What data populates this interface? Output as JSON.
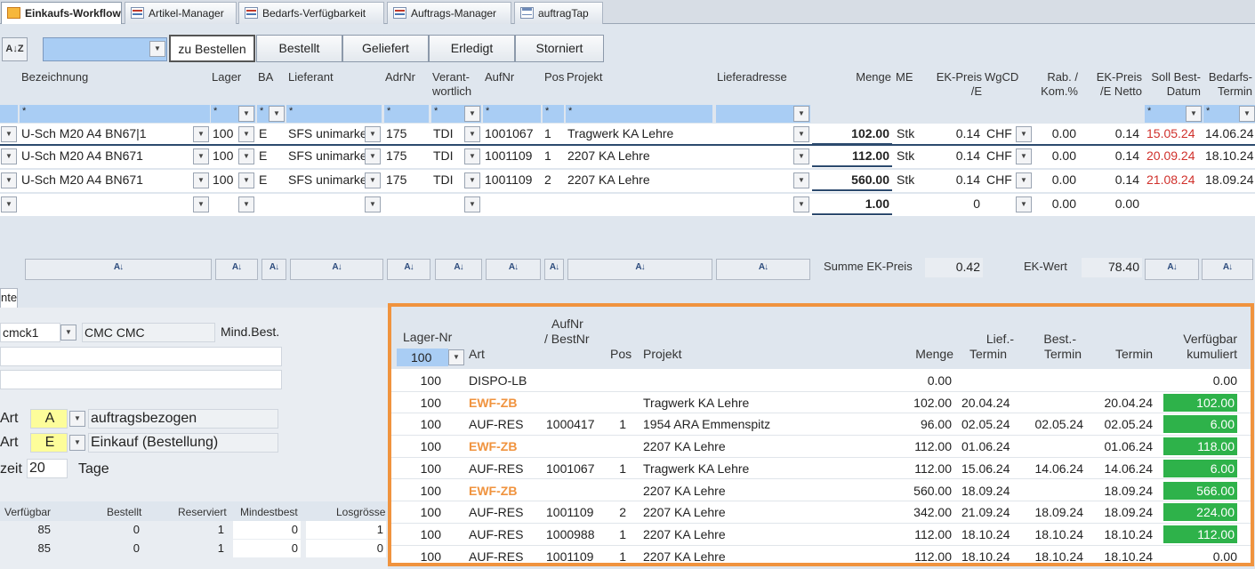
{
  "tabs": [
    {
      "label": "Einkaufs-Workflow",
      "active": true
    },
    {
      "label": "Artikel-Manager"
    },
    {
      "label": "Bedarfs-Verfügbarkeit"
    },
    {
      "label": "Auftrags-Manager"
    },
    {
      "label": "auftragTap"
    }
  ],
  "toolbar": {
    "sort_label": "A↓Z",
    "status_buttons": [
      "zu Bestellen",
      "Bestellt",
      "Geliefert",
      "Erledigt",
      "Storniert"
    ]
  },
  "headers": {
    "bezeichnung": "Bezeichnung",
    "lager": "Lager",
    "ba": "BA",
    "lieferant": "Lieferant",
    "adrnr": "AdrNr",
    "verant1": "Verant-",
    "verant2": "wortlich",
    "aufnr": "AufNr",
    "pos": "Pos",
    "projekt": "Projekt",
    "lieferadresse": "Lieferadresse",
    "menge": "Menge",
    "me": "ME",
    "ekpreis1": "EK-Preis",
    "ekpreis2": "/E",
    "wgcd": "WgCD",
    "rab1": "Rab. /",
    "rab2": "Kom.%",
    "ekpreisnetto1": "EK-Preis",
    "ekpreisnetto2": "/E Netto",
    "soll1": "Soll Best-",
    "soll2": "Datum",
    "bedarf1": "Bedarfs-",
    "bedarf2": "Termin"
  },
  "filter_star": "*",
  "rows": [
    {
      "bezeichnung": "U-Sch M20 A4 BN67|1",
      "lager": "100",
      "ba": "E",
      "lieferant": "SFS unimarke",
      "adrnr": "175",
      "verant": "TDI",
      "aufnr": "1001067",
      "pos": "1",
      "projekt": "Tragwerk KA Lehre",
      "menge": "102.00",
      "me": "Stk",
      "ekpreis": "0.14",
      "wgcd": "CHF",
      "rab": "0.00",
      "netto": "0.14",
      "soll": "15.05.24",
      "termin": "14.06.24"
    },
    {
      "bezeichnung": "U-Sch M20 A4 BN671",
      "lager": "100",
      "ba": "E",
      "lieferant": "SFS unimarke",
      "adrnr": "175",
      "verant": "TDI",
      "aufnr": "1001109",
      "pos": "1",
      "projekt": "2207 KA Lehre",
      "menge": "112.00",
      "me": "Stk",
      "ekpreis": "0.14",
      "wgcd": "CHF",
      "rab": "0.00",
      "netto": "0.14",
      "soll": "20.09.24",
      "termin": "18.10.24"
    },
    {
      "bezeichnung": "U-Sch M20 A4 BN671",
      "lager": "100",
      "ba": "E",
      "lieferant": "SFS unimarke",
      "adrnr": "175",
      "verant": "TDI",
      "aufnr": "1001109",
      "pos": "2",
      "projekt": "2207 KA Lehre",
      "menge": "560.00",
      "me": "Stk",
      "ekpreis": "0.14",
      "wgcd": "CHF",
      "rab": "0.00",
      "netto": "0.14",
      "soll": "21.08.24",
      "termin": "18.09.24"
    },
    {
      "bezeichnung": "",
      "lager": "",
      "ba": "",
      "lieferant": "",
      "adrnr": "",
      "verant": "",
      "aufnr": "",
      "pos": "",
      "projekt": "",
      "menge": "1.00",
      "me": "",
      "ekpreis": "0",
      "wgcd": "",
      "rab": "0.00",
      "netto": "0.00",
      "soll": "",
      "termin": ""
    }
  ],
  "totals": {
    "summe_label": "Summe EK-Preis",
    "summe_value": "0.42",
    "ekwert_label": "EK-Wert",
    "ekwert_value": "78.40"
  },
  "lower": {
    "tab_label": "nte",
    "artikel_code": "cmck1",
    "artikel_name": "CMC CMC",
    "mind_best_label": "Mind.Best.",
    "art1_label": "Art",
    "art1_code": "A",
    "art1_text": "auftragsbezogen",
    "art2_label": "Art",
    "art2_code": "E",
    "art2_text": "Einkauf (Bestellung)",
    "zeit_label": "zeit",
    "zeit_value": "20",
    "zeit_unit": "Tage",
    "stock_headers": [
      "Verfügbar",
      "Bestellt",
      "Reserviert",
      "Mindestbest",
      "Losgrösse"
    ],
    "stock_rows": [
      [
        "85",
        "0",
        "1",
        "0",
        "1"
      ],
      [
        "85",
        "0",
        "1",
        "0",
        "0"
      ]
    ]
  },
  "panel": {
    "headers": {
      "lager": "Lager-Nr",
      "art": "Art",
      "aufnr1": "AufNr",
      "aufnr2": "/ BestNr",
      "pos": "Pos",
      "projekt": "Projekt",
      "menge": "Menge",
      "lief1": "Lief.-",
      "lief2": "Termin",
      "best1": "Best.-",
      "best2": "Termin",
      "termin": "Termin",
      "verf1": "Verfügbar",
      "verf2": "kumuliert"
    },
    "lager_filter": "100",
    "rows": [
      {
        "lager": "100",
        "art": "DISPO-LB",
        "aufnr": "",
        "pos": "",
        "projekt": "",
        "menge": "0.00",
        "lief": "",
        "best": "",
        "termin": "",
        "verf": "0.00",
        "highlight": false,
        "green": false
      },
      {
        "lager": "100",
        "art": "EWF-ZB",
        "aufnr": "",
        "pos": "",
        "projekt": "Tragwerk KA Lehre",
        "menge": "102.00",
        "lief": "20.04.24",
        "best": "",
        "termin": "20.04.24",
        "verf": "102.00",
        "highlight": true,
        "green": true
      },
      {
        "lager": "100",
        "art": "AUF-RES",
        "aufnr": "1000417",
        "pos": "1",
        "projekt": "1954 ARA Emmenspitz",
        "menge": "96.00",
        "lief": "02.05.24",
        "best": "02.05.24",
        "termin": "02.05.24",
        "verf": "6.00",
        "highlight": false,
        "green": true
      },
      {
        "lager": "100",
        "art": "EWF-ZB",
        "aufnr": "",
        "pos": "",
        "projekt": "2207 KA Lehre",
        "menge": "112.00",
        "lief": "01.06.24",
        "best": "",
        "termin": "01.06.24",
        "verf": "118.00",
        "highlight": true,
        "green": true
      },
      {
        "lager": "100",
        "art": "AUF-RES",
        "aufnr": "1001067",
        "pos": "1",
        "projekt": "Tragwerk KA Lehre",
        "menge": "112.00",
        "lief": "15.06.24",
        "best": "14.06.24",
        "termin": "14.06.24",
        "verf": "6.00",
        "highlight": false,
        "green": true
      },
      {
        "lager": "100",
        "art": "EWF-ZB",
        "aufnr": "",
        "pos": "",
        "projekt": "2207 KA Lehre",
        "menge": "560.00",
        "lief": "18.09.24",
        "best": "",
        "termin": "18.09.24",
        "verf": "566.00",
        "highlight": true,
        "green": true
      },
      {
        "lager": "100",
        "art": "AUF-RES",
        "aufnr": "1001109",
        "pos": "2",
        "projekt": "2207 KA Lehre",
        "menge": "342.00",
        "lief": "21.09.24",
        "best": "18.09.24",
        "termin": "18.09.24",
        "verf": "224.00",
        "highlight": false,
        "green": true
      },
      {
        "lager": "100",
        "art": "AUF-RES",
        "aufnr": "1000988",
        "pos": "1",
        "projekt": "2207 KA Lehre",
        "menge": "112.00",
        "lief": "18.10.24",
        "best": "18.10.24",
        "termin": "18.10.24",
        "verf": "112.00",
        "highlight": false,
        "green": true
      },
      {
        "lager": "100",
        "art": "AUF-RES",
        "aufnr": "1001109",
        "pos": "1",
        "projekt": "2207 KA Lehre",
        "menge": "112.00",
        "lief": "18.10.24",
        "best": "18.10.24",
        "termin": "18.10.24",
        "verf": "0.00",
        "highlight": false,
        "green": false
      }
    ]
  },
  "colors": {
    "accent_orange": "#f0933e",
    "highlight_blue": "#a9cdf4",
    "green": "#2eb24a",
    "red_date": "#d0302b"
  }
}
